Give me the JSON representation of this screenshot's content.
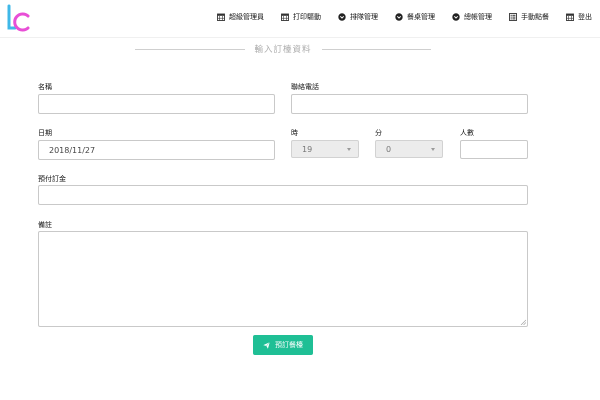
{
  "nav": {
    "items": [
      {
        "label": "超級管理員",
        "icon": "calendar-icon"
      },
      {
        "label": "打印驅動",
        "icon": "calendar-icon"
      },
      {
        "label": "排隊管理",
        "icon": "chevron-circle-icon"
      },
      {
        "label": "餐桌管理",
        "icon": "chevron-circle-icon"
      },
      {
        "label": "總帳管理",
        "icon": "chevron-circle-icon"
      },
      {
        "label": "手動點餐",
        "icon": "list-icon"
      },
      {
        "label": "登出",
        "icon": "calendar-icon"
      }
    ]
  },
  "form": {
    "title": "輸入訂檯資料",
    "name_label": "名稱",
    "name_value": "",
    "phone_label": "聯絡電話",
    "phone_value": "",
    "date_label": "日期",
    "date_value": "2018/11/27",
    "hour_label": "時",
    "hour_value": "19",
    "minute_label": "分",
    "minute_value": "0",
    "people_label": "人數",
    "people_value": "",
    "deposit_label": "預付訂金",
    "deposit_value": "",
    "notes_label": "備註",
    "notes_value": "",
    "submit_label": "預訂餐檯"
  },
  "colors": {
    "accent": "#1fbf95",
    "logo_l": "#3fb8e8",
    "logo_c": "#e84fd6"
  }
}
